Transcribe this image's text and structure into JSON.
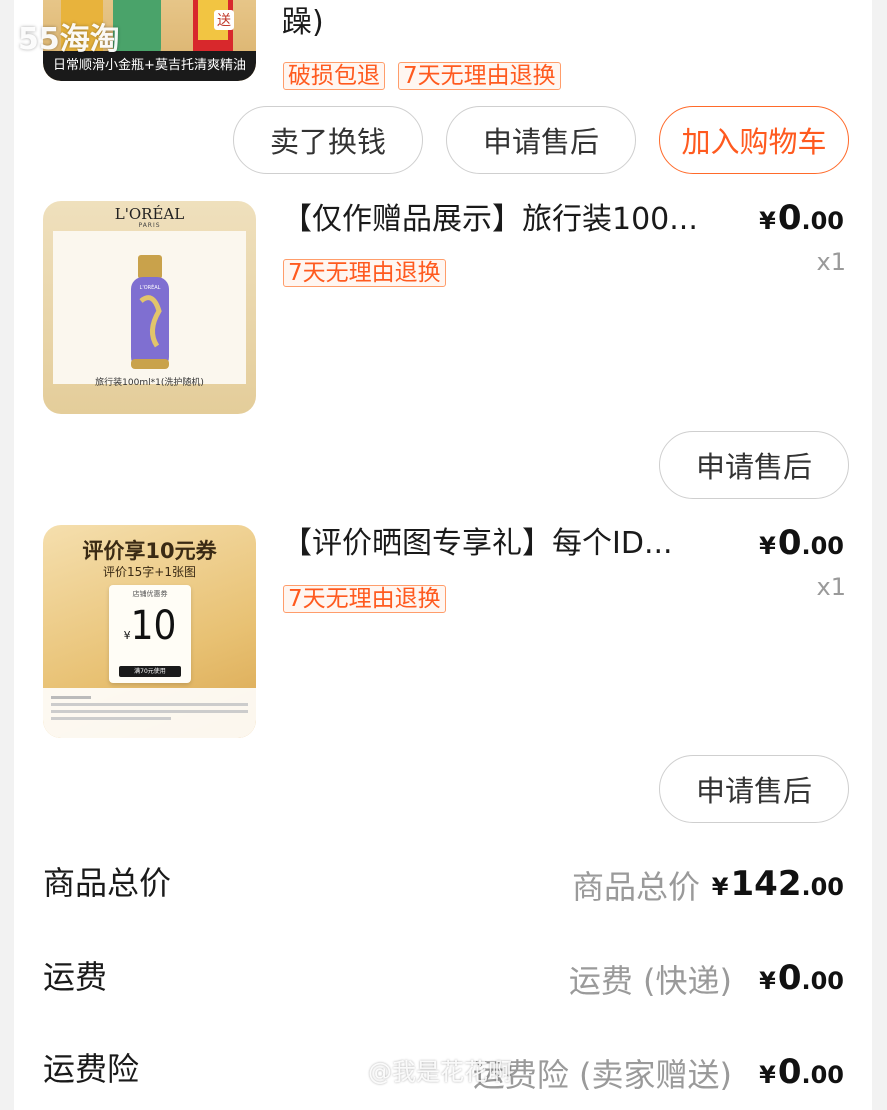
{
  "watermarks": {
    "top_left": "55海淘",
    "bottom_right": "@我是花花啊"
  },
  "item0": {
    "title_tail": "躁)",
    "tags": [
      "破损包退",
      "7天无理由退换"
    ],
    "thumb_caption": "日常顺滑小金瓶+莫吉托清爽精油",
    "thumb_badge": "送",
    "actions": [
      "卖了换钱",
      "申请售后",
      "加入购物车"
    ]
  },
  "item1": {
    "title": "【仅作赠品展示】旅行装100...",
    "tag": "7天无理由退换",
    "price": {
      "currency": "¥",
      "int": "0",
      "dec": ".00"
    },
    "qty": "x1",
    "thumb": {
      "brand": "L'ORÉAL",
      "brand_sub": "PARIS",
      "bottle_text": "L'ORÉAL",
      "caption": "旅行装100ml*1(洗护随机)"
    },
    "action": "申请售后"
  },
  "item2": {
    "title": "【评价晒图专享礼】每个ID...",
    "tag": "7天无理由退换",
    "price": {
      "currency": "¥",
      "int": "0",
      "dec": ".00"
    },
    "qty": "x1",
    "thumb": {
      "headline": "评价享10元券",
      "sub": "评价15字+1张图",
      "coupon_label": "店铺优惠券",
      "coupon_cur": "¥",
      "coupon_value": "10",
      "coupon_cond": "满70元使用"
    },
    "action": "申请售后"
  },
  "summary": [
    {
      "label": "商品总价",
      "sub": "商品总价",
      "currency": "¥",
      "int": "142",
      "dec": ".00"
    },
    {
      "label": "运费",
      "sub": "运费 (快递)",
      "currency": "¥",
      "int": "0",
      "dec": ".00"
    },
    {
      "label": "运费险",
      "sub": "运费险 (卖家赠送)",
      "currency": "¥",
      "int": "0",
      "dec": ".00"
    }
  ],
  "colors": {
    "accent": "#ff5a1f",
    "tag_border": "#ff9d6b",
    "muted": "#9a9a9a"
  }
}
